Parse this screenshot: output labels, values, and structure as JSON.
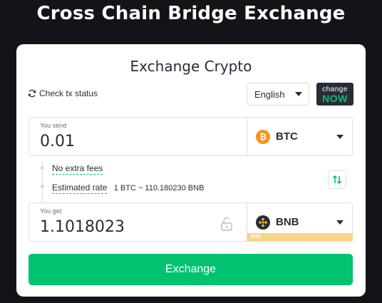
{
  "page": {
    "title": "Cross Chain Bridge Exchange"
  },
  "card": {
    "title": "Exchange Crypto",
    "check_status": "Check tx status",
    "language": "English",
    "logo": {
      "top": "change",
      "bottom": "NOW"
    }
  },
  "send": {
    "label": "You send",
    "amount": "0.01",
    "currency": {
      "name": "BTC",
      "icon": "bitcoin-icon",
      "symbol": "₿",
      "color": "#f7931a"
    }
  },
  "info": {
    "fees": "No extra fees",
    "rate_label": "Estimated rate",
    "rate_value": "1 BTC ~ 110.180230 BNB"
  },
  "get": {
    "label": "You get",
    "amount": "1.1018023",
    "currency": {
      "name": "BNB",
      "icon": "bnb-icon",
      "network": "BSC",
      "color": "#f3ba2f"
    }
  },
  "actions": {
    "exchange_label": "Exchange"
  },
  "colors": {
    "accent": "#00c26f",
    "background": "#121417",
    "card": "#ffffff"
  }
}
